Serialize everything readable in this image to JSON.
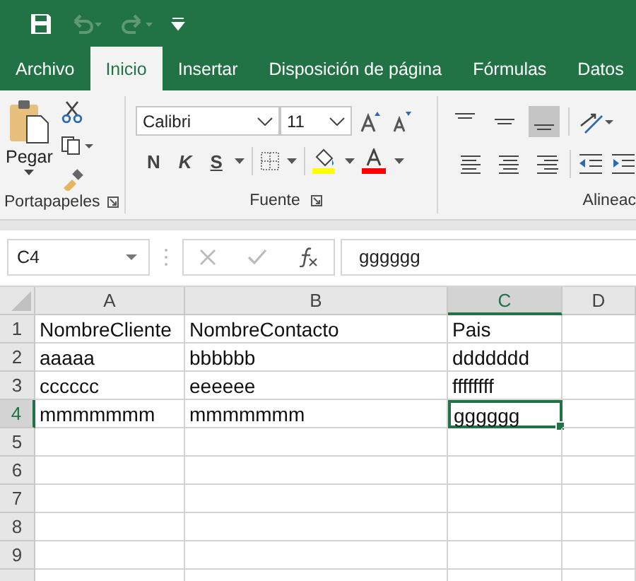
{
  "quick_access": [
    {
      "kind": "save",
      "disabled": false
    },
    {
      "kind": "undo",
      "disabled": true
    },
    {
      "kind": "redo",
      "disabled": true
    },
    {
      "kind": "customize",
      "disabled": false
    }
  ],
  "tabs": [
    {
      "label": "Archivo",
      "selected": false
    },
    {
      "label": "Inicio",
      "selected": true
    },
    {
      "label": "Insertar",
      "selected": false
    },
    {
      "label": "Disposición de página",
      "selected": false
    },
    {
      "label": "Fórmulas",
      "selected": false
    },
    {
      "label": "Datos",
      "selected": false
    }
  ],
  "ribbon": {
    "clipboard": {
      "paste_label": "Pegar",
      "group_label": "Portapapeles"
    },
    "font": {
      "family": "Calibri",
      "size": "11",
      "bold_key": "N",
      "italic_key": "K",
      "underline_key": "S",
      "group_label": "Fuente"
    },
    "alignment": {
      "vertical": [
        {
          "kind": "top",
          "selected": false
        },
        {
          "kind": "middle",
          "selected": false
        },
        {
          "kind": "bottom",
          "selected": true
        }
      ],
      "horizontal": [
        {
          "kind": "left",
          "selected": false
        },
        {
          "kind": "center",
          "selected": false
        },
        {
          "kind": "right",
          "selected": false
        }
      ],
      "group_label": "Alineac"
    }
  },
  "formula_bar": {
    "name_box": "C4",
    "value": "gggggg"
  },
  "sheet": {
    "columns": [
      {
        "label": "A",
        "selected": false
      },
      {
        "label": "B",
        "selected": false
      },
      {
        "label": "C",
        "selected": true
      },
      {
        "label": "D",
        "selected": false
      }
    ],
    "rows": [
      {
        "label": "1",
        "selected": false,
        "cells": [
          {
            "text": "NombreCliente",
            "active": false
          },
          {
            "text": "NombreContacto",
            "active": false
          },
          {
            "text": "Pais",
            "active": false
          }
        ]
      },
      {
        "label": "2",
        "selected": false,
        "cells": [
          {
            "text": "aaaaa",
            "active": false
          },
          {
            "text": "bbbbbb",
            "active": false
          },
          {
            "text": "ddddddd",
            "active": false
          }
        ]
      },
      {
        "label": "3",
        "selected": false,
        "cells": [
          {
            "text": "cccccc",
            "active": false
          },
          {
            "text": "eeeeee",
            "active": false
          },
          {
            "text": "ffffffff",
            "active": false
          }
        ]
      },
      {
        "label": "4",
        "selected": true,
        "cells": [
          {
            "text": "mmmmmmm",
            "active": false
          },
          {
            "text": "mmmmmmm",
            "active": false
          },
          {
            "text": "gggggg",
            "active": true
          }
        ]
      },
      {
        "label": "5",
        "selected": false
      },
      {
        "label": "6",
        "selected": false
      },
      {
        "label": "7",
        "selected": false
      },
      {
        "label": "8",
        "selected": false
      },
      {
        "label": "9",
        "selected": false
      }
    ]
  }
}
